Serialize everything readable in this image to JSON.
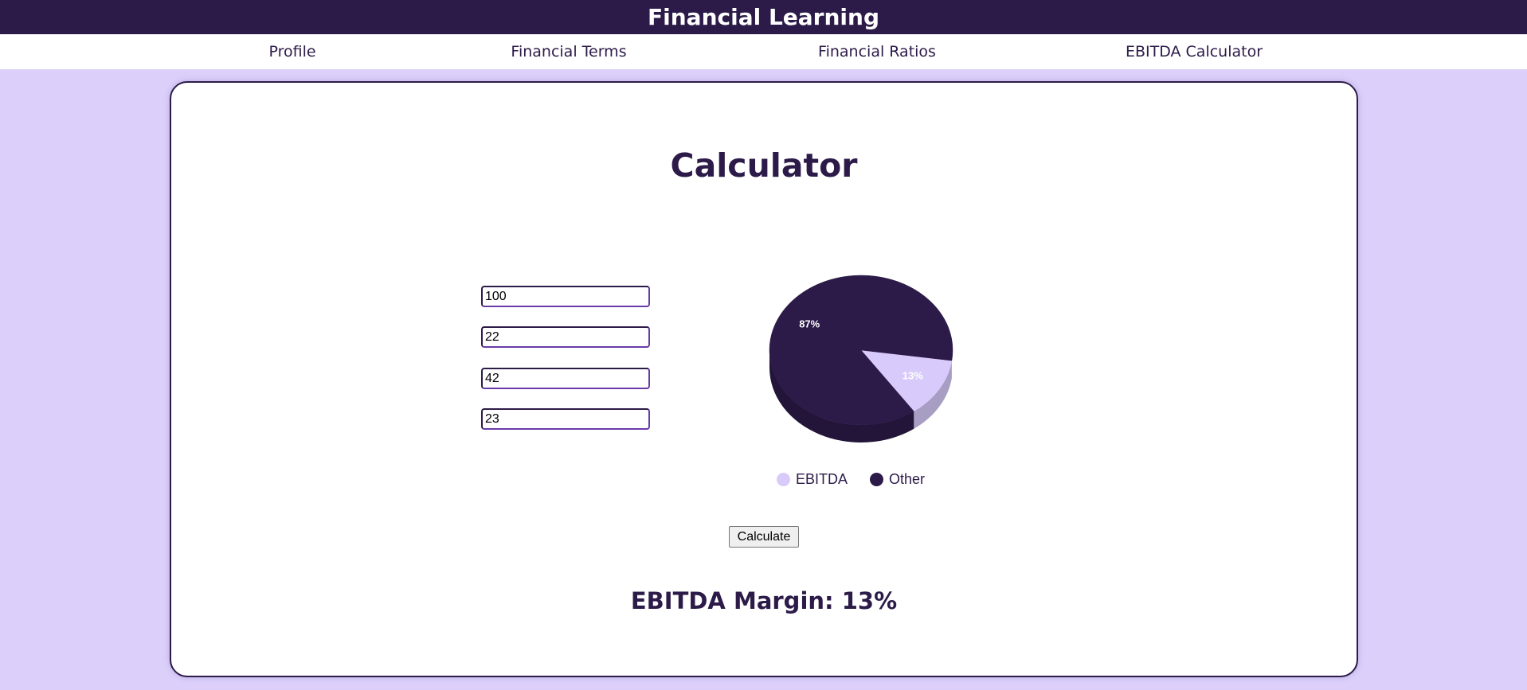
{
  "header": {
    "title": "Financial Learning"
  },
  "nav": {
    "items": [
      {
        "label": "Profile"
      },
      {
        "label": "Financial Terms"
      },
      {
        "label": "Financial Ratios"
      },
      {
        "label": "EBITDA Calculator"
      }
    ]
  },
  "calculator": {
    "title": "Calculator",
    "inputs": [
      {
        "value": "100"
      },
      {
        "value": "22"
      },
      {
        "value": "42"
      },
      {
        "value": "23"
      }
    ],
    "button_label": "Calculate",
    "result_text": "EBITDA Margin: 13%"
  },
  "colors": {
    "header_bg": "#2c1b49",
    "page_bg": "#dcd0fb",
    "ebitda": "#d8cbfb",
    "other": "#2c1b49"
  },
  "chart_data": {
    "type": "pie",
    "slices": [
      {
        "label": "EBITDA",
        "value": 13,
        "display": "13%",
        "color": "#d8cbfb"
      },
      {
        "label": "Other",
        "value": 87,
        "display": "87%",
        "color": "#2c1b49"
      }
    ],
    "legend_position": "bottom",
    "style": "3d"
  }
}
